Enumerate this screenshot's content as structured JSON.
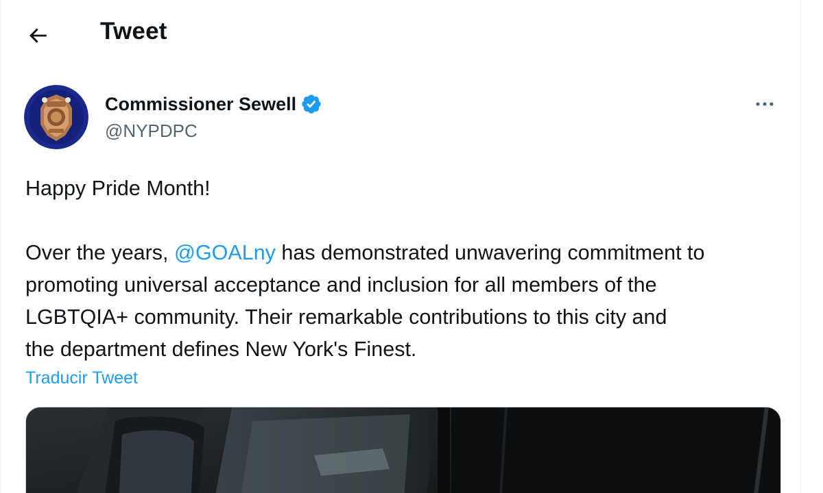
{
  "header": {
    "title": "Tweet",
    "back_icon": "arrow-left-icon"
  },
  "author": {
    "display_name": "Commissioner Sewell",
    "handle": "@NYPDPC",
    "verified": true,
    "verified_color": "#1d9bf0",
    "avatar_icon": "nypd-badge-avatar"
  },
  "tweet": {
    "line1": "Happy Pride Month!",
    "line2_prefix": "Over the years, ",
    "mention": "@GOALny",
    "line2_suffix": " has demonstrated unwavering commitment to",
    "line3": "promoting universal acceptance and inclusion for all members of the",
    "line4": "LGBTQIA+ community. Their remarkable contributions to this city and",
    "line5": "the department defines New York's Finest.",
    "translate_label": "Traducir Tweet"
  },
  "colors": {
    "accent": "#1d9bf0",
    "text": "#0f1419",
    "secondary_text": "#536471"
  }
}
